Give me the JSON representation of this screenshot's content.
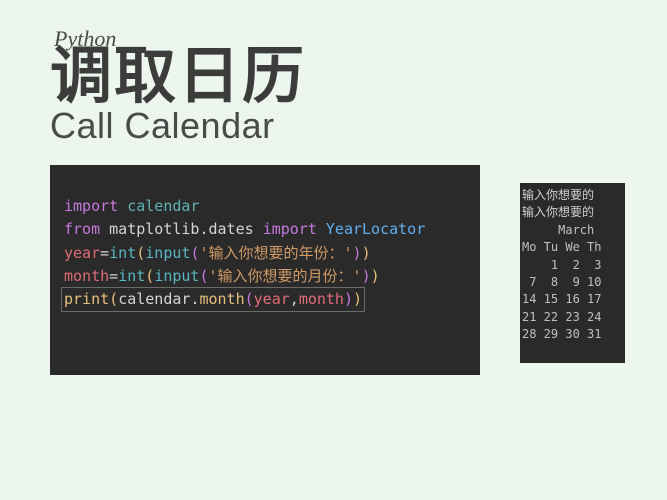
{
  "header": {
    "subtitle": "Python",
    "title_zh": "调取日历",
    "title_en": "Call Calendar"
  },
  "code": {
    "line1": {
      "kw_import": "import",
      "mod": "calendar"
    },
    "line2": {
      "kw_from": "from",
      "mod": "matplotlib.dates",
      "kw_import": "import",
      "cls": "YearLocator"
    },
    "line3": {
      "var": "year",
      "op": "=",
      "fn_int": "int",
      "fn_input": "input",
      "str": "'输入你想要的年份：'"
    },
    "line4": {
      "var": "month",
      "op": "=",
      "fn_int": "int",
      "fn_input": "input",
      "str": "'输入你想要的月份：'"
    },
    "line5": {
      "fn_print": "print",
      "obj": "calendar",
      "method": "month",
      "arg1": "year",
      "arg2": "month"
    }
  },
  "output": {
    "prompt1": "输入你想要的",
    "prompt2": "输入你想要的",
    "month_header": "     March ",
    "weekdays": "Mo Tu We Th ",
    "row1": "    1  2  3 ",
    "row2": " 7  8  9 10 ",
    "row3": "14 15 16 17 ",
    "row4": "21 22 23 24 ",
    "row5": "28 29 30 31 "
  }
}
